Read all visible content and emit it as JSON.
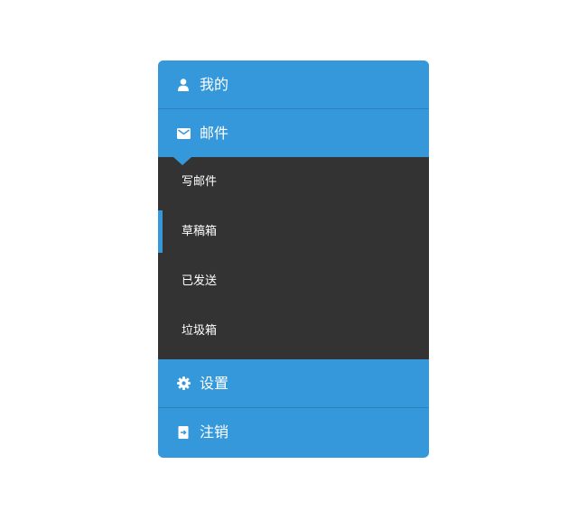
{
  "menu": {
    "items_top": [
      {
        "label": "我的",
        "icon": "user-icon"
      },
      {
        "label": "邮件",
        "icon": "mail-icon"
      }
    ],
    "submenu": [
      {
        "label": "写邮件",
        "active": false
      },
      {
        "label": "草稿箱",
        "active": true
      },
      {
        "label": "已发送",
        "active": false
      },
      {
        "label": "垃圾箱",
        "active": false
      }
    ],
    "items_bottom": [
      {
        "label": "设置",
        "icon": "gear-icon"
      },
      {
        "label": "注销",
        "icon": "logout-icon"
      }
    ]
  },
  "colors": {
    "accent": "#3498db",
    "submenu_bg": "#333333",
    "text": "#ffffff"
  }
}
